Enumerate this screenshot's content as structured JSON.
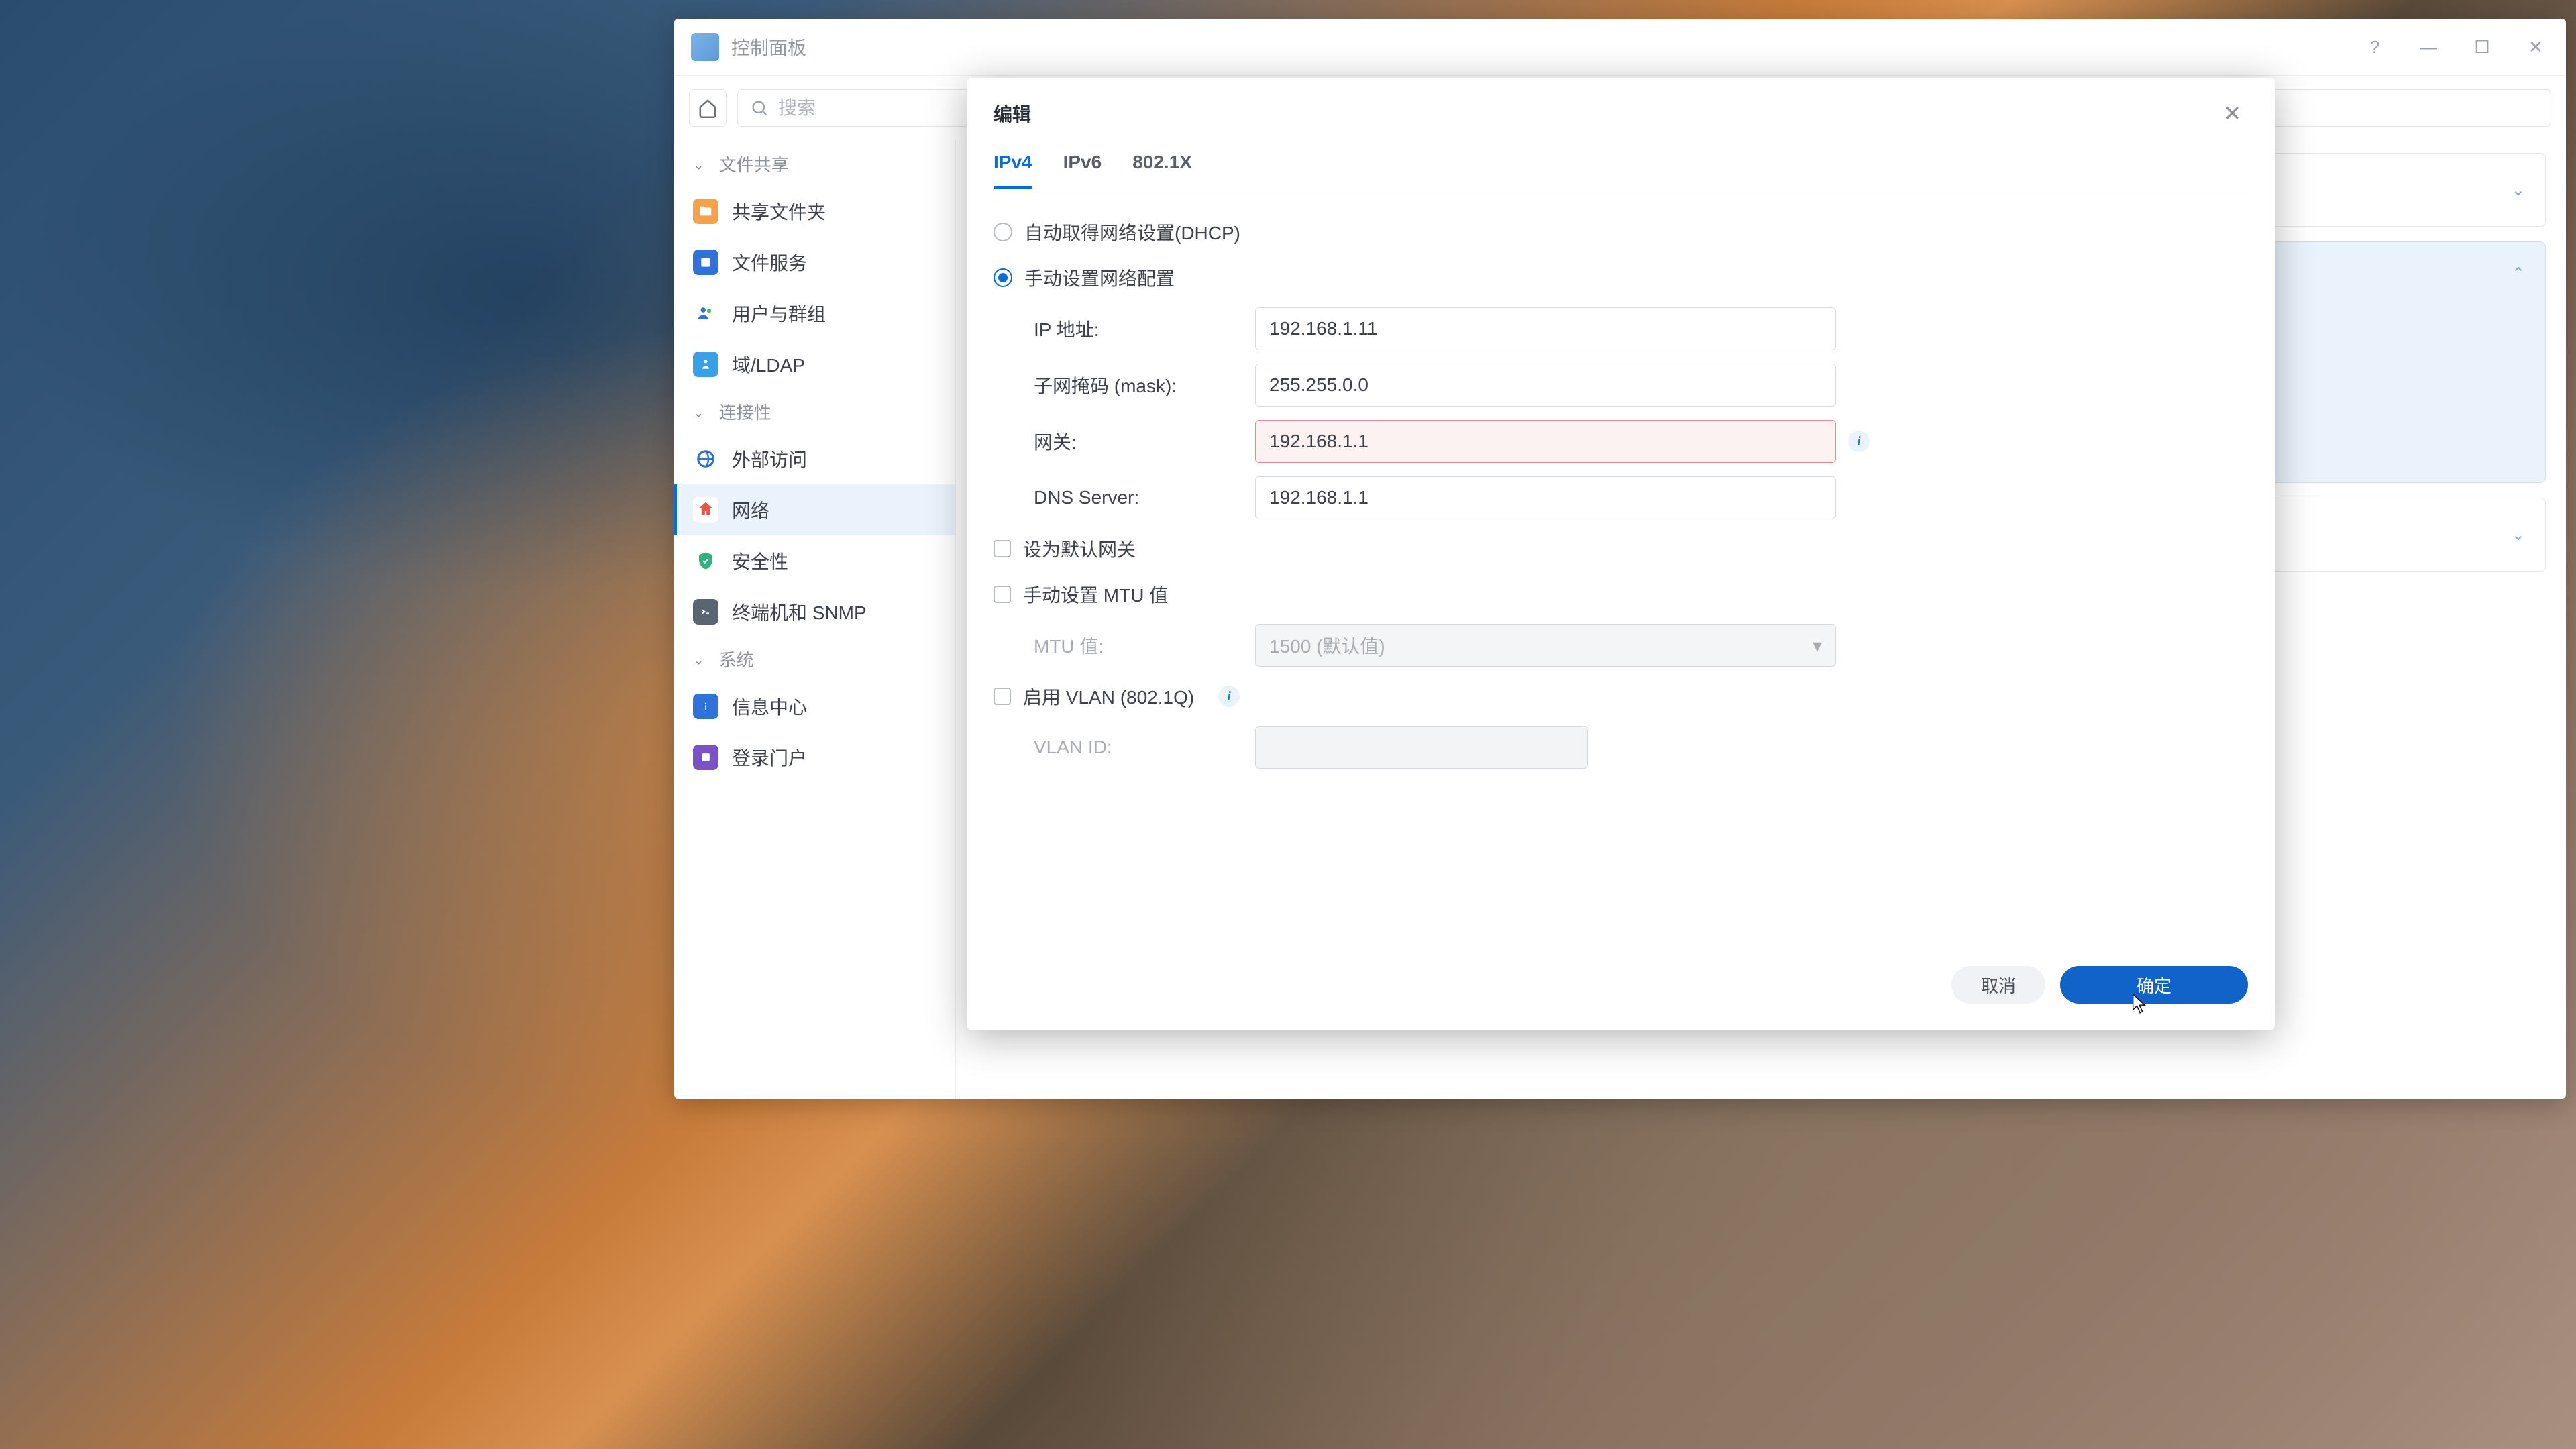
{
  "window": {
    "title": "控制面板"
  },
  "search": {
    "placeholder": "搜索"
  },
  "sidebar": {
    "sections": {
      "file_sharing": "文件共享",
      "connectivity": "连接性",
      "system": "系统"
    },
    "items": {
      "shared_folder": "共享文件夹",
      "file_services": "文件服务",
      "user_group": "用户与群组",
      "domain_ldap": "域/LDAP",
      "external_access": "外部访问",
      "network": "网络",
      "security": "安全性",
      "terminal_snmp": "终端机和 SNMP",
      "info_center": "信息中心",
      "login_portal": "登录门户"
    }
  },
  "modal": {
    "title": "编辑",
    "tabs": {
      "ipv4": "IPv4",
      "ipv6": "IPv6",
      "dot1x": "802.1X"
    },
    "options": {
      "dhcp_auto": "自动取得网络设置(DHCP)",
      "manual": "手动设置网络配置"
    },
    "fields": {
      "ip_label": "IP 地址:",
      "ip_value": "192.168.1.11",
      "subnet_label": "子网掩码 (mask):",
      "subnet_value": "255.255.0.0",
      "gateway_label": "网关:",
      "gateway_value": "192.168.1.1",
      "dns_label": "DNS Server:",
      "dns_value": "192.168.1.1",
      "default_gateway": "设为默认网关",
      "manual_mtu": "手动设置 MTU 值",
      "mtu_label": "MTU 值:",
      "mtu_value": "1500 (默认值)",
      "vlan_enable": "启用 VLAN (802.1Q)",
      "vlan_id_label": "VLAN ID:"
    },
    "buttons": {
      "cancel": "取消",
      "ok": "确定"
    }
  }
}
